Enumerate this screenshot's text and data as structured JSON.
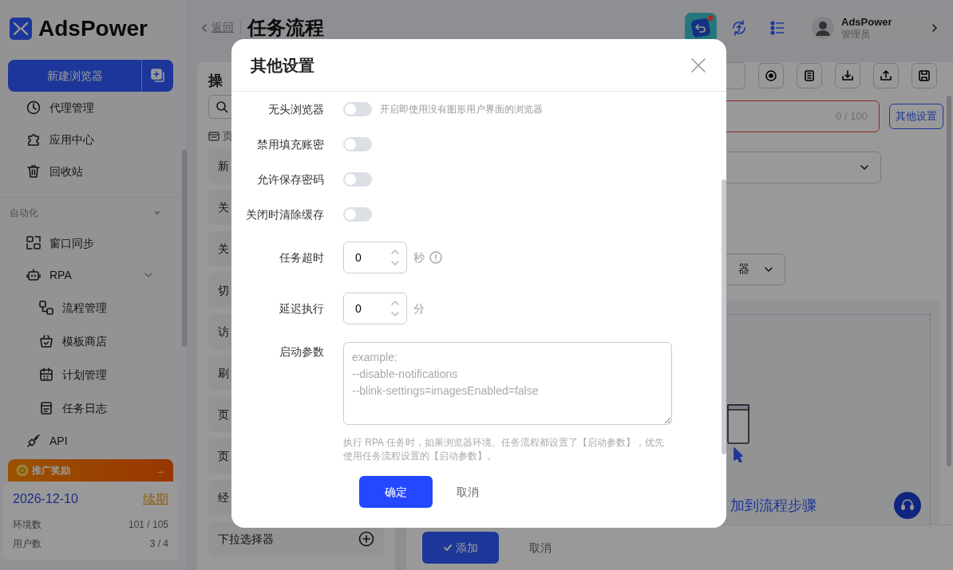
{
  "sidebar": {
    "brand": "AdsPower",
    "new_browser_button": "新建浏览器",
    "menu": [
      {
        "kind": "item",
        "label": "代理管理"
      },
      {
        "kind": "item",
        "label": "应用中心"
      },
      {
        "kind": "item",
        "label": "回收站"
      },
      {
        "kind": "section",
        "label": "自动化",
        "expanded": true,
        "children": [
          {
            "kind": "item",
            "label": "窗口同步"
          },
          {
            "kind": "item",
            "label": "RPA",
            "expanded": true,
            "children": [
              {
                "kind": "item",
                "label": "流程管理"
              },
              {
                "kind": "item",
                "label": "模板商店"
              },
              {
                "kind": "item",
                "label": "计划管理"
              },
              {
                "kind": "item",
                "label": "任务日志"
              }
            ]
          },
          {
            "kind": "item",
            "label": "API"
          }
        ]
      }
    ],
    "promo": {
      "title": "推广奖励",
      "arrow": "→",
      "date": "2026-12-10",
      "renew_link": "续期",
      "stats": [
        {
          "label": "环境数",
          "value": "101 / 105"
        },
        {
          "label": "用户数",
          "value": "3 / 4"
        }
      ]
    }
  },
  "header": {
    "back": "返回",
    "title": "任务流程",
    "notification": true,
    "user": {
      "name": "AdsPower",
      "role": "管理员"
    }
  },
  "left_panel": {
    "title": "操",
    "section": "页",
    "items": [
      "新",
      "关",
      "关",
      "切",
      "访",
      "刷",
      "页",
      "页",
      "经",
      "下拉选择器"
    ]
  },
  "editor": {
    "counter": "0 / 100",
    "other_settings_button": "其他设置",
    "select_fragment": "器",
    "drop_hint": "加到流程步骤",
    "add_button": "添加",
    "cancel_button": "取消"
  },
  "modal": {
    "title": "其他设置",
    "switches": [
      {
        "label": "无头浏览器",
        "on": false,
        "hint": "开启即使用没有图形用户界面的浏览器"
      },
      {
        "label": "禁用填充账密",
        "on": false
      },
      {
        "label": "允许保存密码",
        "on": false
      },
      {
        "label": "关闭时清除缓存",
        "on": false
      }
    ],
    "numbers": [
      {
        "label": "任务超时",
        "value": "0",
        "unit": "秒",
        "info": true
      },
      {
        "label": "延迟执行",
        "value": "0",
        "unit": "分",
        "info": false
      }
    ],
    "launch_args": {
      "label": "启动参数",
      "placeholder": "example:\n--disable-notifications\n--blink-settings=imagesEnabled=false",
      "help": "执行 RPA 任务时，如果浏览器环境、任务流程都设置了【启动参数】，优先使用任务流程设置的【启动参数】。"
    },
    "ok_button": "确定",
    "cancel_button": "取消"
  }
}
